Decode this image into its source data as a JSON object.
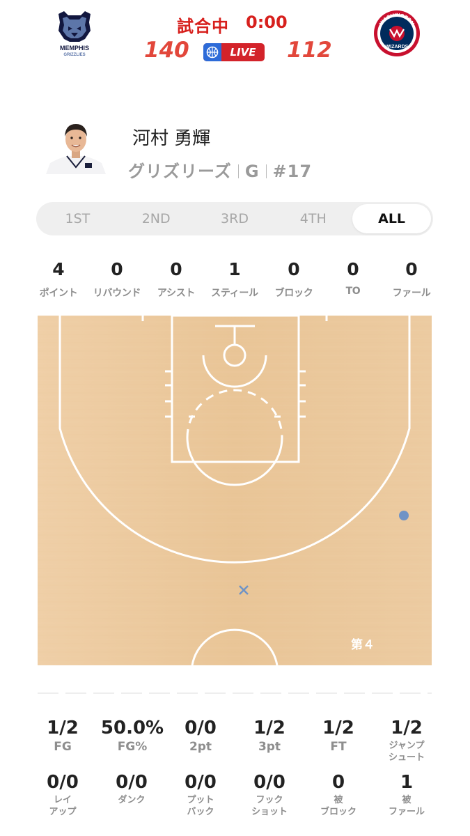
{
  "header": {
    "game_status": "試合中",
    "game_clock": "0:00",
    "home_score": "140",
    "away_score": "112",
    "live_label": "LIVE",
    "home_logo_text": [
      "MEMPHIS",
      "GRIZZLIES"
    ],
    "away_logo_text": [
      "WASHINGTON",
      "WIZARDS"
    ],
    "colors": {
      "score": "#e2473b",
      "live_bg": "#d3232a",
      "home_navy": "#12173f",
      "home_blue": "#5d76a9",
      "away_red": "#c8102e",
      "away_navy": "#002b5c"
    }
  },
  "player": {
    "name": "河村 勇輝",
    "team": "グリズリーズ",
    "position": "G",
    "number": "#17"
  },
  "tabs": [
    {
      "label": "1ST",
      "active": false
    },
    {
      "label": "2ND",
      "active": false
    },
    {
      "label": "3RD",
      "active": false
    },
    {
      "label": "4TH",
      "active": false
    },
    {
      "label": "ALL",
      "active": true
    }
  ],
  "stats": [
    {
      "value": "4",
      "label": "ポイント"
    },
    {
      "value": "0",
      "label": "リバウンド"
    },
    {
      "value": "0",
      "label": "アシスト"
    },
    {
      "value": "1",
      "label": "スティール"
    },
    {
      "value": "0",
      "label": "ブロック"
    },
    {
      "value": "0",
      "label": "TO"
    },
    {
      "value": "0",
      "label": "ファール"
    }
  ],
  "court": {
    "quarter_label": "第４",
    "shots": [
      {
        "result": "made",
        "color": "#6f93c6"
      },
      {
        "result": "missed",
        "color": "#6f93c6"
      }
    ],
    "colors": {
      "wood": "#ebc699",
      "lines": "#ffffff"
    }
  },
  "shooting": {
    "row1": [
      {
        "value": "1/2",
        "label": "FG"
      },
      {
        "value": "50.0%",
        "label": "FG%"
      },
      {
        "value": "0/0",
        "label": "2pt"
      },
      {
        "value": "1/2",
        "label": "3pt"
      },
      {
        "value": "1/2",
        "label": "FT"
      },
      {
        "value": "1/2",
        "label": "ジャンプシュート",
        "label_lines": [
          "ジャンプ",
          "シュート"
        ]
      }
    ],
    "row2": [
      {
        "value": "0/0",
        "label": "レイアップ",
        "label_lines": [
          "レイ",
          "アップ"
        ]
      },
      {
        "value": "0/0",
        "label": "ダンク",
        "label_lines": [
          "ダンク"
        ]
      },
      {
        "value": "0/0",
        "label": "プットバック",
        "label_lines": [
          "プット",
          "バック"
        ]
      },
      {
        "value": "0/0",
        "label": "フックショット",
        "label_lines": [
          "フック",
          "ショット"
        ]
      },
      {
        "value": "0",
        "label": "被ブロック",
        "label_lines": [
          "被",
          "ブロック"
        ]
      },
      {
        "value": "1",
        "label": "被ファール",
        "label_lines": [
          "被",
          "ファール"
        ]
      }
    ]
  }
}
